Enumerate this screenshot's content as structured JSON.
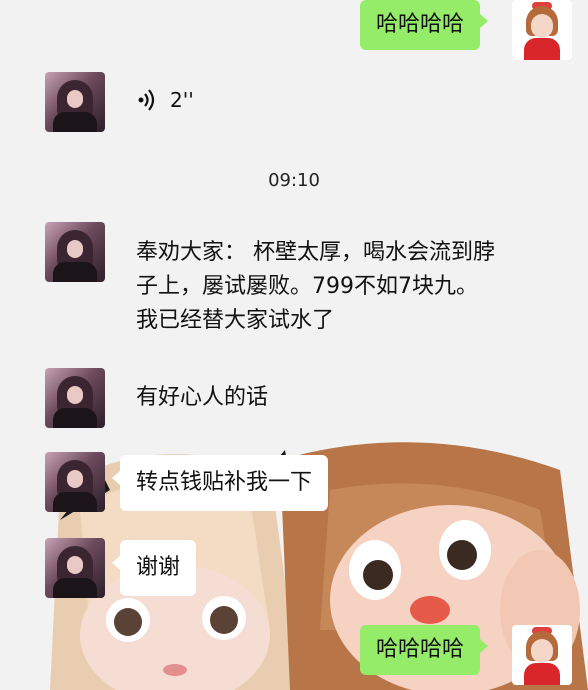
{
  "messages": [
    {
      "id": "m1",
      "side": "out",
      "text": "哈哈哈哈"
    },
    {
      "id": "m2",
      "side": "in",
      "type": "voice",
      "duration": "2''"
    },
    {
      "id": "m3",
      "side": "in",
      "text": "奉劝大家： 杯壁太厚，喝水会流到脖子上，屡试屡败。799不如7块九。我已经替大家试水了"
    },
    {
      "id": "m4",
      "side": "in",
      "text": "有好心人的话"
    },
    {
      "id": "m5",
      "side": "in",
      "text": "转点钱贴补我一下"
    },
    {
      "id": "m6",
      "side": "in",
      "text": "谢谢"
    },
    {
      "id": "m7",
      "side": "out",
      "text": "哈哈哈哈"
    }
  ],
  "timestamp": "09:10",
  "icons": {
    "voice": "voice-wave-icon"
  },
  "colors": {
    "outgoing_bubble": "#95ec69",
    "incoming_bubble": "#ffffff",
    "chat_background": "#f2f2f2"
  }
}
